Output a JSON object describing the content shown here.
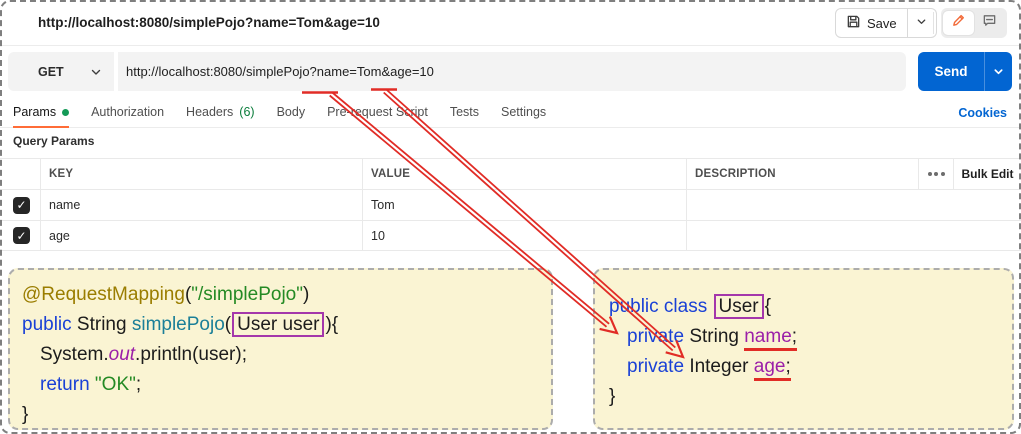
{
  "titlebar": {
    "title": "http://localhost:8080/simplePojo?name=Tom&age=10",
    "save_label": "Save"
  },
  "request": {
    "method": "GET",
    "url": "http://localhost:8080/simplePojo?name=Tom&age=10",
    "send_label": "Send"
  },
  "tabs": [
    {
      "label": "Params",
      "active": true,
      "dot": true
    },
    {
      "label": "Authorization"
    },
    {
      "label": "Headers",
      "count": "(6)"
    },
    {
      "label": "Body"
    },
    {
      "label": "Pre-request Script"
    },
    {
      "label": "Tests"
    },
    {
      "label": "Settings"
    }
  ],
  "cookies_label": "Cookies",
  "section_title": "Query Params",
  "table": {
    "columns": {
      "key": "KEY",
      "value": "VALUE",
      "description": "DESCRIPTION"
    },
    "bulk_edit_label": "Bulk Edit",
    "check_glyph": "✓",
    "rows": [
      {
        "checked": true,
        "key": "name",
        "value": "Tom",
        "description": ""
      },
      {
        "checked": true,
        "key": "age",
        "value": "10",
        "description": ""
      }
    ]
  },
  "code_blocks": {
    "left": {
      "lines": [
        {
          "indent": 0,
          "tokens": [
            {
              "text": "@RequestMapping",
              "style": "anno"
            },
            {
              "text": "(",
              "style": "plain"
            },
            {
              "text": "\"/simplePojo\"",
              "style": "str"
            },
            {
              "text": ")",
              "style": "plain"
            }
          ]
        },
        {
          "indent": 0,
          "tokens": [
            {
              "text": "public ",
              "style": "kw"
            },
            {
              "text": "String ",
              "style": "plain"
            },
            {
              "text": "simplePojo",
              "style": "method"
            },
            {
              "text": "(",
              "style": "plain"
            },
            {
              "text": "User user",
              "style": "plain",
              "box": true
            },
            {
              "text": "){",
              "style": "plain"
            }
          ]
        },
        {
          "indent": 1,
          "tokens": [
            {
              "text": "System.",
              "style": "plain"
            },
            {
              "text": "out",
              "style": "field",
              "italic": true
            },
            {
              "text": ".println(user);",
              "style": "plain"
            }
          ]
        },
        {
          "indent": 1,
          "tokens": [
            {
              "text": "return ",
              "style": "kw"
            },
            {
              "text": "\"OK\"",
              "style": "str"
            },
            {
              "text": ";",
              "style": "plain"
            }
          ]
        },
        {
          "indent": 0,
          "tokens": [
            {
              "text": "}",
              "style": "plain"
            }
          ]
        }
      ]
    },
    "right": {
      "lines": [
        {
          "indent": 0,
          "tokens": [
            {
              "text": "public class ",
              "style": "kw"
            },
            {
              "text": "User",
              "style": "plain",
              "box": true
            },
            {
              "text": "{",
              "style": "plain"
            }
          ]
        },
        {
          "indent": 1,
          "tokens": [
            {
              "text": "private ",
              "style": "kw"
            },
            {
              "text": "String ",
              "style": "plain"
            },
            {
              "text": "name",
              "style": "field",
              "underline": true
            },
            {
              "text": ";",
              "style": "plain",
              "underline": true
            }
          ]
        },
        {
          "indent": 1,
          "tokens": [
            {
              "text": "private ",
              "style": "kw"
            },
            {
              "text": "Integer ",
              "style": "plain"
            },
            {
              "text": "age",
              "style": "field",
              "underline": true
            },
            {
              "text": ";",
              "style": "plain",
              "underline": true
            }
          ]
        },
        {
          "indent": 0,
          "tokens": [
            {
              "text": "}",
              "style": "plain"
            }
          ]
        }
      ]
    }
  },
  "icons": {
    "save": "floppy-disk",
    "save_caret": "chevron-down",
    "edit": "pencil",
    "comment": "speech-bubble",
    "method_caret": "chevron-down",
    "send_caret": "chevron-down",
    "params_dot": "green-dot",
    "more_options": "three-dots"
  },
  "colors": {
    "accent_orange": "#ff6c37",
    "send_blue": "#0265d2",
    "link_blue": "#0265d2",
    "annotation_red": "#e12c26",
    "box_purple": "#a437ab",
    "code_bg": "#faf4d3",
    "kw": "#1a41d6",
    "anno": "#9a7d00",
    "str": "#248a24",
    "method": "#1b7f98",
    "field": "#9b1fa8",
    "count_green": "#0a7d3b",
    "dot_green": "#149a57"
  }
}
